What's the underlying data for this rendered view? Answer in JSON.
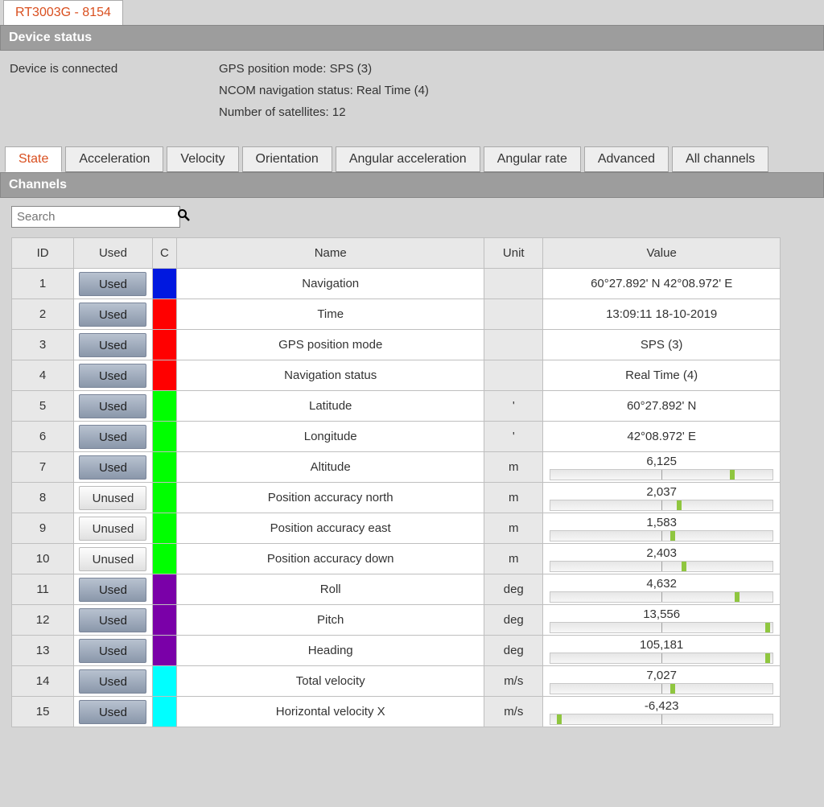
{
  "device_tab": "RT3003G - 8154",
  "device_status": {
    "header": "Device status",
    "connection": "Device is connected",
    "gps_mode": "GPS position mode: SPS (3)",
    "ncom_status": "NCOM navigation status: Real Time (4)",
    "satellites": "Number of satellites: 12"
  },
  "tabs": [
    "State",
    "Acceleration",
    "Velocity",
    "Orientation",
    "Angular acceleration",
    "Angular rate",
    "Advanced",
    "All channels"
  ],
  "active_tab_index": 0,
  "channels_header": "Channels",
  "search_placeholder": "Search",
  "table": {
    "headers": {
      "id": "ID",
      "used": "Used",
      "c": "C",
      "name": "Name",
      "unit": "Unit",
      "value": "Value"
    },
    "used_label": "Used",
    "unused_label": "Unused",
    "rows": [
      {
        "id": "1",
        "used": true,
        "color": "#0018e0",
        "name": "Navigation",
        "unit": "",
        "value": "60°27.892' N  42°08.972' E",
        "bar": null
      },
      {
        "id": "2",
        "used": true,
        "color": "#ff0000",
        "name": "Time",
        "unit": "",
        "value": "13:09:11 18-10-2019",
        "bar": null
      },
      {
        "id": "3",
        "used": true,
        "color": "#ff0000",
        "name": "GPS position mode",
        "unit": "",
        "value": "SPS (3)",
        "bar": null
      },
      {
        "id": "4",
        "used": true,
        "color": "#ff0000",
        "name": "Navigation status",
        "unit": "",
        "value": "Real Time (4)",
        "bar": null
      },
      {
        "id": "5",
        "used": true,
        "color": "#00ff00",
        "name": "Latitude",
        "unit": "'",
        "value": "60°27.892' N",
        "bar": null
      },
      {
        "id": "6",
        "used": true,
        "color": "#00ff00",
        "name": "Longitude",
        "unit": "'",
        "value": "42°08.972' E",
        "bar": null
      },
      {
        "id": "7",
        "used": true,
        "color": "#00ff00",
        "name": "Altitude",
        "unit": "m",
        "value": "6,125",
        "bar": 0.82
      },
      {
        "id": "8",
        "used": false,
        "color": "#00ff00",
        "name": "Position accuracy north",
        "unit": "m",
        "value": "2,037",
        "bar": 0.58
      },
      {
        "id": "9",
        "used": false,
        "color": "#00ff00",
        "name": "Position accuracy east",
        "unit": "m",
        "value": "1,583",
        "bar": 0.55
      },
      {
        "id": "10",
        "used": false,
        "color": "#00ff00",
        "name": "Position accuracy down",
        "unit": "m",
        "value": "2,403",
        "bar": 0.6
      },
      {
        "id": "11",
        "used": true,
        "color": "#7a00a8",
        "name": "Roll",
        "unit": "deg",
        "value": "4,632",
        "bar": 0.84
      },
      {
        "id": "12",
        "used": true,
        "color": "#7a00a8",
        "name": "Pitch",
        "unit": "deg",
        "value": "13,556",
        "bar": 0.98
      },
      {
        "id": "13",
        "used": true,
        "color": "#7a00a8",
        "name": "Heading",
        "unit": "deg",
        "value": "105,181",
        "bar": 0.98
      },
      {
        "id": "14",
        "used": true,
        "color": "#00ffff",
        "name": "Total velocity",
        "unit": "m/s",
        "value": "7,027",
        "bar": 0.55
      },
      {
        "id": "15",
        "used": true,
        "color": "#00ffff",
        "name": "Horizontal velocity X",
        "unit": "m/s",
        "value": "-6,423",
        "bar": 0.04
      }
    ]
  }
}
